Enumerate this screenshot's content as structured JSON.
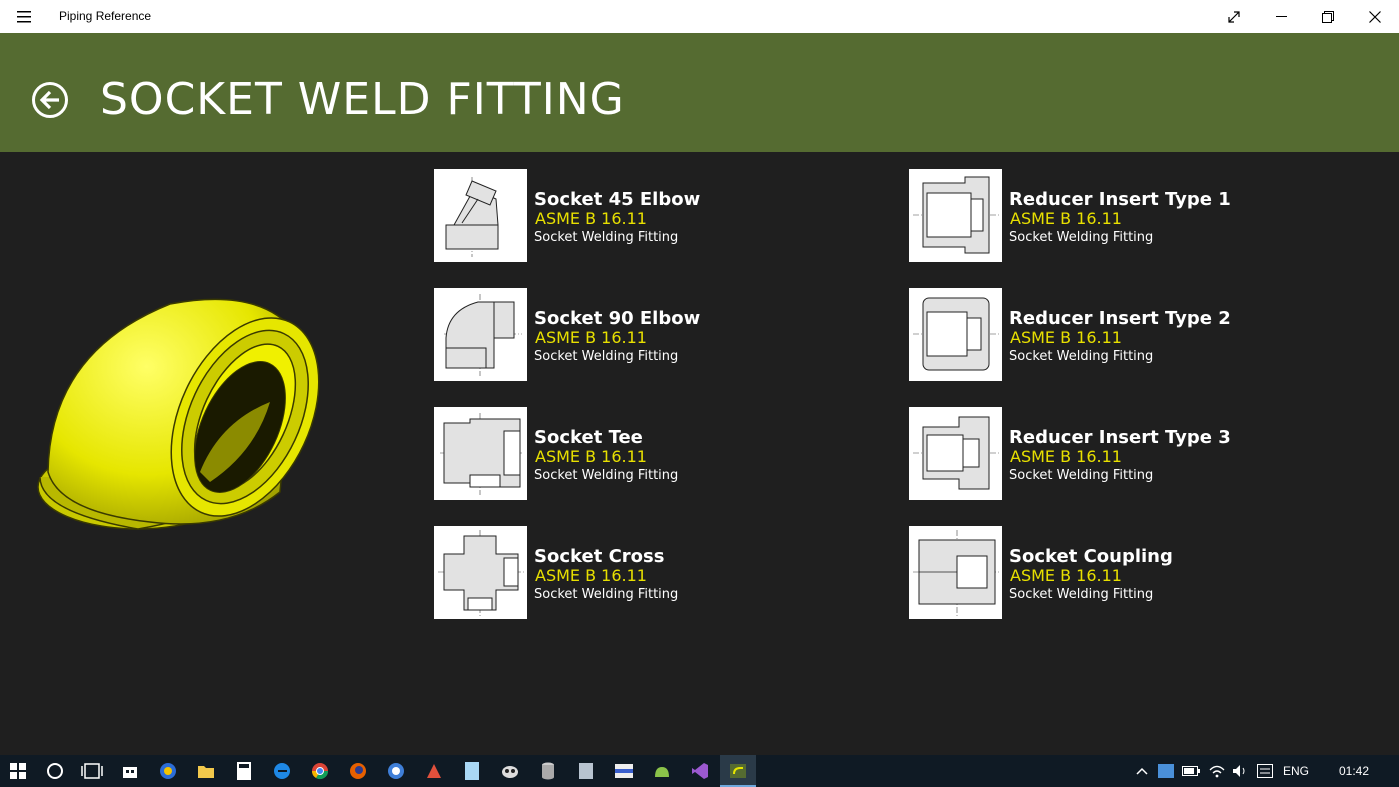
{
  "window": {
    "title": "Piping Reference"
  },
  "header": {
    "title": "SOCKET WELD FITTING"
  },
  "items": [
    {
      "name": "Socket 45 Elbow",
      "standard": "ASME B 16.11",
      "description": "Socket Welding Fitting",
      "icon": "socket-45-elbow-drawing"
    },
    {
      "name": "Socket 90 Elbow",
      "standard": "ASME B 16.11",
      "description": "Socket Welding Fitting",
      "icon": "socket-90-elbow-drawing"
    },
    {
      "name": "Socket Tee",
      "standard": "ASME B 16.11",
      "description": "Socket Welding Fitting",
      "icon": "socket-tee-drawing"
    },
    {
      "name": "Socket Cross",
      "standard": "ASME B 16.11",
      "description": "Socket Welding Fitting",
      "icon": "socket-cross-drawing"
    },
    {
      "name": "Reducer Insert Type 1",
      "standard": "ASME B 16.11",
      "description": "Socket Welding Fitting",
      "icon": "reducer-insert-1-drawing"
    },
    {
      "name": "Reducer Insert Type 2",
      "standard": "ASME B 16.11",
      "description": "Socket Welding Fitting",
      "icon": "reducer-insert-2-drawing"
    },
    {
      "name": "Reducer Insert Type 3",
      "standard": "ASME B 16.11",
      "description": "Socket Welding Fitting",
      "icon": "reducer-insert-3-drawing"
    },
    {
      "name": "Socket Coupling",
      "standard": "ASME B 16.11",
      "description": "Socket Welding Fitting",
      "icon": "socket-coupling-drawing"
    }
  ],
  "taskbar": {
    "language": "ENG",
    "time": "01:42"
  },
  "colors": {
    "header": "#556b31",
    "background": "#1f1f1f",
    "standard_text": "#e8e000",
    "hero_fill": "#e6e600"
  }
}
